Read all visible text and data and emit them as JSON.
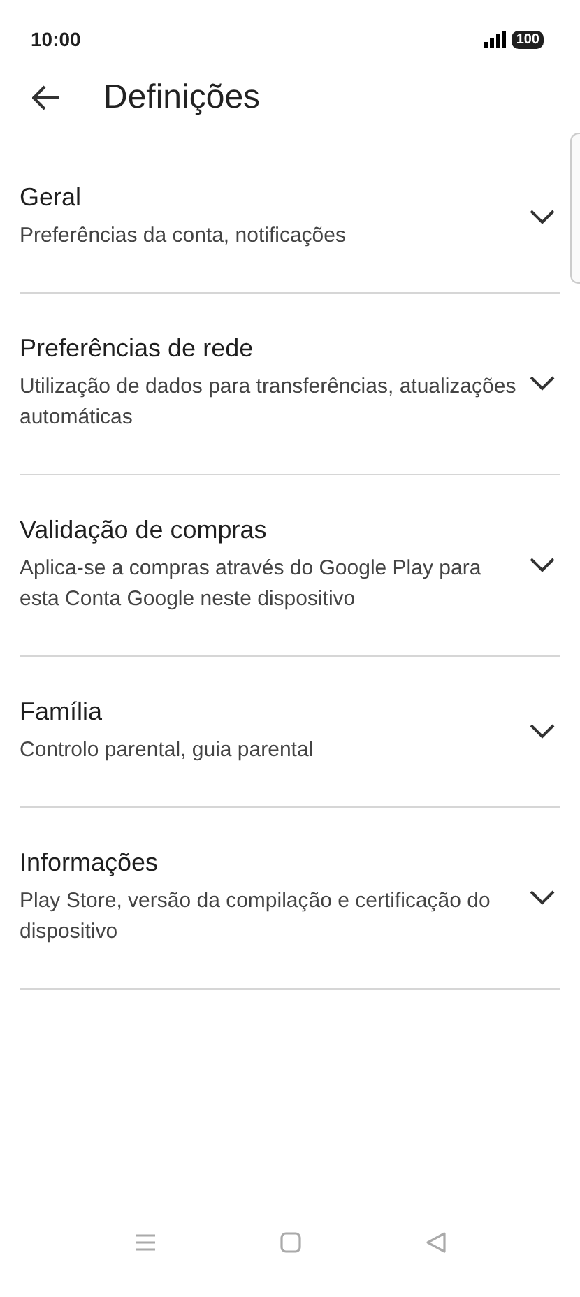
{
  "status_bar": {
    "time": "10:00",
    "battery": "100"
  },
  "header": {
    "title": "Definições"
  },
  "sections": [
    {
      "title": "Geral",
      "subtitle": "Preferências da conta, notificações",
      "expanded": false
    },
    {
      "title": "Preferências de rede",
      "subtitle": "Utilização de dados para transferências, atualizações automáticas",
      "expanded": false
    },
    {
      "title": "Validação de compras",
      "subtitle": "Aplica-se a compras através do Google Play para esta Conta Google neste dispositivo",
      "expanded": false
    },
    {
      "title": "Família",
      "subtitle": "Controlo parental, guia parental",
      "expanded": false
    },
    {
      "title": "Informações",
      "subtitle": "Play Store, versão da compilação e certificação do dispositivo",
      "expanded": false
    }
  ]
}
